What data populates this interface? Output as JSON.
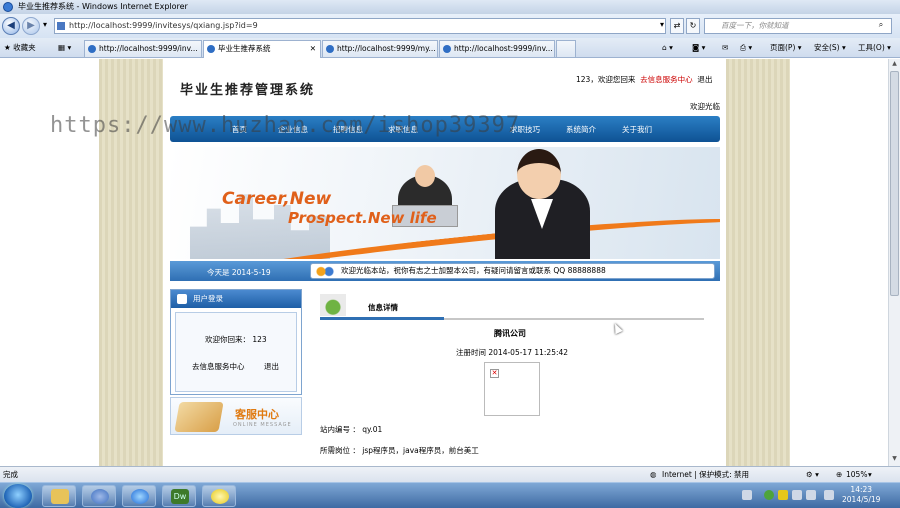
{
  "window": {
    "title": "毕业生推荐系统 - Windows Internet Explorer"
  },
  "address": {
    "url": "http://localhost:9999/invitesys/qxiang.jsp?id=9",
    "search_placeholder": "百度一下，你就知道"
  },
  "tabs": {
    "favorites": "收藏夹",
    "items": [
      {
        "label": "http://localhost:9999/inv..."
      },
      {
        "label": "毕业生推荐系统"
      },
      {
        "label": "http://localhost:9999/my..."
      },
      {
        "label": "http://localhost:9999/inv..."
      }
    ],
    "commands": {
      "page": "页面(P) ▾",
      "safety": "安全(S) ▾",
      "tools": "工具(O) ▾"
    }
  },
  "site": {
    "title": "毕业生推荐管理系统",
    "user": "123，欢迎您回来",
    "user_center": "去信息服务中心",
    "logout": "退出",
    "welcome": "欢迎光临",
    "nav": [
      "首页",
      "企业信息",
      "招聘信息",
      "求职信息",
      "求职技巧",
      "系统简介",
      "关于我们"
    ],
    "banner": {
      "line1": "Career,New",
      "line2": "Prospect.New life"
    },
    "today": "今天是 2014-5-19",
    "ticker": "欢迎光临本站，祝你有志之士加盟本公司，有疑问请留言或联系 QQ 88888888"
  },
  "login_box": {
    "header": "用户登录",
    "welcome": "欢迎你回来： 123",
    "center_link": "去信息服务中心",
    "logout_link": "退出"
  },
  "service_box": {
    "title": "客服中心",
    "subtitle": "ONLINE MESSAGE"
  },
  "info": {
    "header": "信息详情",
    "company": "腾讯公司",
    "reg_time": "注册时间 2014-05-17 11:25:42",
    "station_no": "站内编号 ： qy.01",
    "positions": "所需岗位 ： jsp程序员，java程序员，前台美工"
  },
  "watermark": "https://www.huzhan.com/ishop39397",
  "statusbar": {
    "left": "完成",
    "zone": "Internet | 保护模式: 禁用",
    "zoom": "105%"
  },
  "taskbar": {
    "time": "14:23",
    "date": "2014/5/19"
  }
}
